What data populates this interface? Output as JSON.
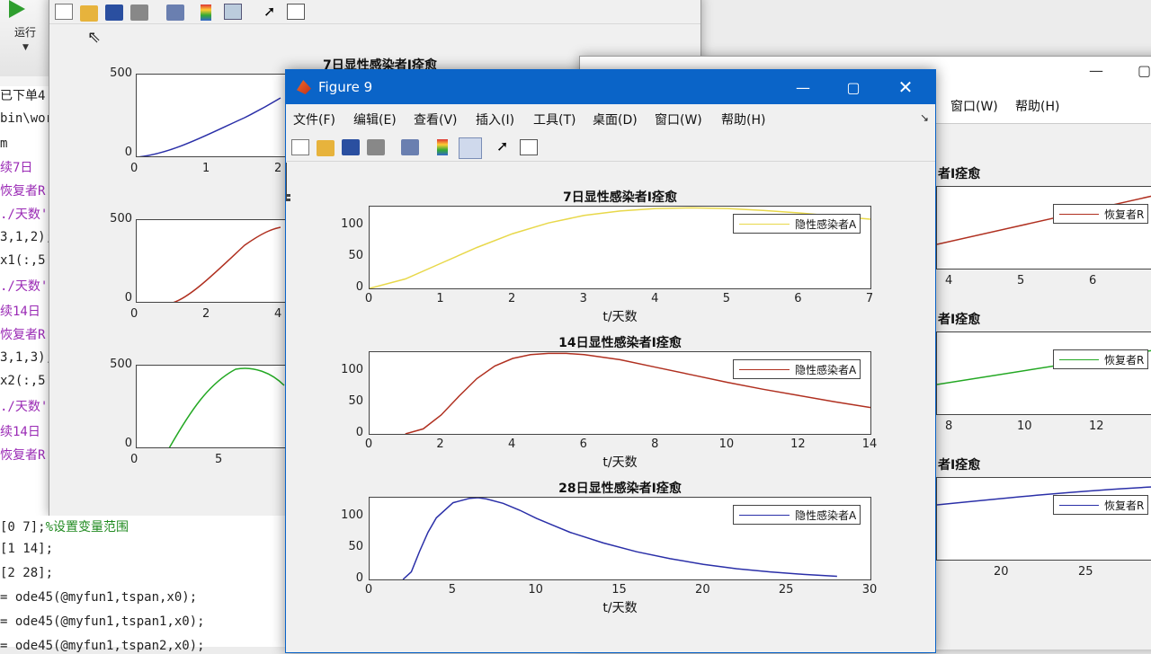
{
  "matlab": {
    "run_label": "运行",
    "editor_lines": [
      {
        "text": "已下单4",
        "cls": ""
      },
      {
        "text": "bin\\wor",
        "cls": ""
      },
      {
        "text": "m",
        "cls": ""
      },
      {
        "text": "续7日",
        "cls": "purple"
      },
      {
        "text": "恢复者R",
        "cls": "purple"
      },
      {
        "text": "./天数'",
        "cls": "purple"
      },
      {
        "text": "3,1,2);",
        "cls": ""
      },
      {
        "text": "x1(:,5",
        "cls": ""
      },
      {
        "text": "./天数'",
        "cls": "purple"
      },
      {
        "text": "续14日",
        "cls": "purple"
      },
      {
        "text": "恢复者R",
        "cls": "purple"
      },
      {
        "text": "3,1,3);",
        "cls": ""
      },
      {
        "text": "x2(:,5",
        "cls": ""
      },
      {
        "text": "./天数'",
        "cls": "purple"
      },
      {
        "text": "续14日",
        "cls": "purple"
      },
      {
        "text": "恢复者R",
        "cls": "purple"
      }
    ],
    "code_lines": [
      {
        "prefix": "[0 7];",
        "comment": "%设置变量范围"
      },
      {
        "prefix": "[1 14];",
        "comment": ""
      },
      {
        "prefix": "[2 28];",
        "comment": ""
      },
      {
        "prefix": "= ode45(@myfun1,tspan,x0);",
        "comment": ""
      },
      {
        "prefix": "= ode45(@myfun1,tspan1,x0);",
        "comment": ""
      },
      {
        "prefix": "= ode45(@myfun1,tspan2,x0);",
        "comment": ""
      }
    ]
  },
  "back_figure_left": {
    "title_partial": "7日显性感染者I痊愈",
    "axes": [
      {
        "yticks": [
          "500",
          "0"
        ],
        "xticks": [
          "0",
          "1",
          "2"
        ],
        "color": "#2a2fa8"
      },
      {
        "yticks": [
          "500",
          "0"
        ],
        "xticks": [
          "0",
          "2",
          "4"
        ],
        "color": "#b03020"
      },
      {
        "yticks": [
          "500",
          "0"
        ],
        "xticks": [
          "0",
          "5"
        ],
        "color": "#23a823"
      }
    ]
  },
  "back_figure_right": {
    "menu": [
      "窗口(W)",
      "帮助(H)"
    ],
    "titles": [
      "者I痊愈",
      "者I痊愈",
      "者I痊愈"
    ],
    "legend": "恢复者R",
    "axes": [
      {
        "xticks": [
          "4",
          "5",
          "6"
        ],
        "color": "#b03020"
      },
      {
        "xticks": [
          "8",
          "10",
          "12"
        ],
        "color": "#23a823"
      },
      {
        "xticks": [
          "20",
          "25"
        ],
        "color": "#2a2fa8"
      }
    ]
  },
  "figure9": {
    "title": "Figure 9",
    "menu": [
      "文件(F)",
      "编辑(E)",
      "查看(V)",
      "插入(I)",
      "工具(T)",
      "桌面(D)",
      "窗口(W)",
      "帮助(H)"
    ],
    "accent": "#0a64c8"
  },
  "chart_data": [
    {
      "type": "line",
      "title": "7日显性感染者I痊愈",
      "xlabel": "t/天数",
      "ylabel": "",
      "xlim": [
        0,
        7
      ],
      "ylim": [
        0,
        130
      ],
      "xticks": [
        0,
        1,
        2,
        3,
        4,
        5,
        6,
        7
      ],
      "yticks": [
        0,
        50,
        100
      ],
      "legend_location": "top-right",
      "series": [
        {
          "name": "隐性感染者A",
          "color": "#e8d84a",
          "x": [
            0,
            0.5,
            1,
            1.5,
            2,
            2.5,
            3,
            3.5,
            4,
            4.5,
            5,
            5.5,
            6,
            6.5,
            7
          ],
          "y": [
            0,
            15,
            40,
            65,
            87,
            104,
            116,
            123,
            127,
            128,
            127,
            124,
            120,
            115,
            110
          ]
        }
      ]
    },
    {
      "type": "line",
      "title": "14日显性感染者I痊愈",
      "xlabel": "t/天数",
      "ylabel": "",
      "xlim": [
        0,
        14
      ],
      "ylim": [
        0,
        130
      ],
      "xticks": [
        0,
        2,
        4,
        6,
        8,
        10,
        12,
        14
      ],
      "yticks": [
        0,
        50,
        100
      ],
      "legend_location": "top-right",
      "series": [
        {
          "name": "隐性感染者A",
          "color": "#b03020",
          "x": [
            1,
            1.5,
            2,
            2.5,
            3,
            3.5,
            4,
            4.5,
            5,
            5.5,
            6,
            7,
            8,
            9,
            10,
            11,
            12,
            13,
            14
          ],
          "y": [
            0,
            8,
            30,
            60,
            88,
            108,
            120,
            126,
            128,
            128,
            126,
            118,
            106,
            94,
            82,
            71,
            61,
            51,
            42
          ]
        }
      ]
    },
    {
      "type": "line",
      "title": "28日显性感染者I痊愈",
      "xlabel": "t/天数",
      "ylabel": "",
      "xlim": [
        0,
        30
      ],
      "ylim": [
        0,
        130
      ],
      "xticks": [
        0,
        5,
        10,
        15,
        20,
        25,
        30
      ],
      "yticks": [
        0,
        50,
        100
      ],
      "legend_location": "top-right",
      "series": [
        {
          "name": "隐性感染者A",
          "color": "#2a2fa8",
          "x": [
            2,
            2.5,
            3,
            3.5,
            4,
            5,
            6,
            6.5,
            7,
            8,
            9,
            10,
            11,
            12,
            14,
            16,
            18,
            20,
            22,
            24,
            26,
            28
          ],
          "y": [
            0,
            12,
            45,
            75,
            98,
            122,
            129,
            130,
            128,
            121,
            110,
            97,
            86,
            75,
            58,
            44,
            33,
            24,
            17,
            12,
            8,
            5
          ]
        }
      ]
    }
  ]
}
